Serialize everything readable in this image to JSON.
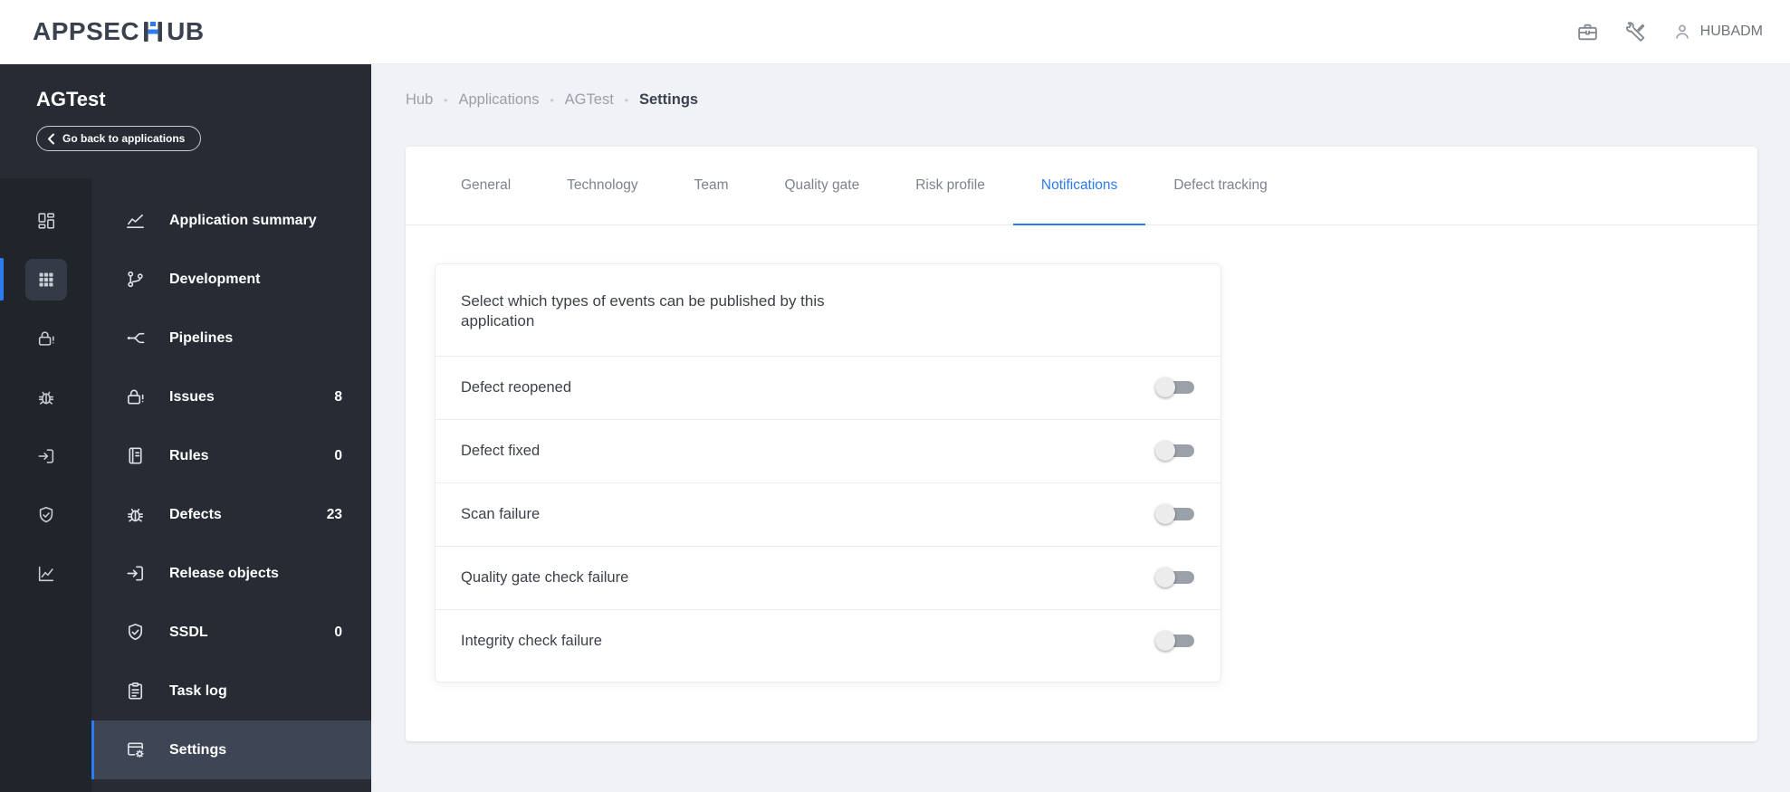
{
  "colors": {
    "accent": "#2b7cf0",
    "sidebar_bg": "#262b34",
    "rail_bg": "#20242b",
    "active_item_bg": "#3e4554",
    "main_bg": "#f1f2f5"
  },
  "header": {
    "logo_left": "APPSEC",
    "logo_right": "UB",
    "user": "HUBADM"
  },
  "sidebar": {
    "app_name": "AGTest",
    "back_label": "Go back to applications",
    "rail": [
      {
        "name": "dashboard-icon",
        "active": false
      },
      {
        "name": "applications-icon",
        "active": true
      },
      {
        "name": "lock-alert-icon",
        "active": false
      },
      {
        "name": "bug-icon",
        "active": false
      },
      {
        "name": "release-icon",
        "active": false
      },
      {
        "name": "shield-icon",
        "active": false
      },
      {
        "name": "metrics-icon",
        "active": false
      }
    ],
    "items": [
      {
        "label": "Application summary",
        "count": "",
        "active": false
      },
      {
        "label": "Development",
        "count": "",
        "active": false
      },
      {
        "label": "Pipelines",
        "count": "",
        "active": false
      },
      {
        "label": "Issues",
        "count": "8",
        "active": false
      },
      {
        "label": "Rules",
        "count": "0",
        "active": false
      },
      {
        "label": "Defects",
        "count": "23",
        "active": false
      },
      {
        "label": "Release objects",
        "count": "",
        "active": false
      },
      {
        "label": "SSDL",
        "count": "0",
        "active": false
      },
      {
        "label": "Task log",
        "count": "",
        "active": false
      },
      {
        "label": "Settings",
        "count": "",
        "active": true
      }
    ]
  },
  "breadcrumb": {
    "separator": "•",
    "items": [
      {
        "label": "Hub",
        "current": false
      },
      {
        "label": "Applications",
        "current": false
      },
      {
        "label": "AGTest",
        "current": false
      },
      {
        "label": "Settings",
        "current": true
      }
    ]
  },
  "tabs": [
    {
      "label": "General",
      "active": false
    },
    {
      "label": "Technology",
      "active": false
    },
    {
      "label": "Team",
      "active": false
    },
    {
      "label": "Quality gate",
      "active": false
    },
    {
      "label": "Risk profile",
      "active": false
    },
    {
      "label": "Notifications",
      "active": true
    },
    {
      "label": "Defect tracking",
      "active": false
    }
  ],
  "panel": {
    "description": "Select which types of events can be published by this application",
    "toggles": [
      {
        "label": "Defect reopened",
        "on": false
      },
      {
        "label": "Defect fixed",
        "on": false
      },
      {
        "label": "Scan failure",
        "on": false
      },
      {
        "label": "Quality gate check failure",
        "on": false
      },
      {
        "label": "Integrity check failure",
        "on": false
      }
    ]
  }
}
